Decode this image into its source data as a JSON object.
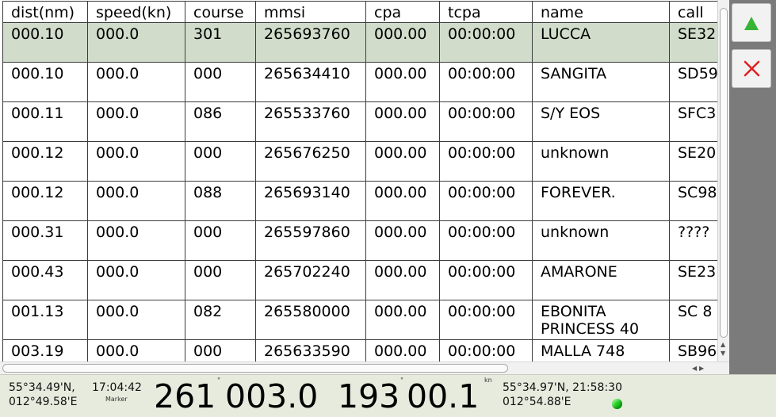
{
  "table": {
    "columns": [
      "dist(nm)",
      "speed(kn)",
      "course",
      "mmsi",
      "cpa",
      "tcpa",
      "name",
      "call"
    ],
    "rows": [
      {
        "dist": "000.10",
        "speed": "000.0",
        "course": "301",
        "mmsi": "265693760",
        "cpa": "000.00",
        "tcpa": "00:00:00",
        "name": "LUCCA",
        "call": "SE32"
      },
      {
        "dist": "000.10",
        "speed": "000.0",
        "course": "000",
        "mmsi": "265634410",
        "cpa": "000.00",
        "tcpa": "00:00:00",
        "name": "SANGITA",
        "call": "SD59"
      },
      {
        "dist": "000.11",
        "speed": "000.0",
        "course": "086",
        "mmsi": "265533760",
        "cpa": "000.00",
        "tcpa": "00:00:00",
        "name": "S/Y EOS",
        "call": "SFC3"
      },
      {
        "dist": "000.12",
        "speed": "000.0",
        "course": "000",
        "mmsi": "265676250",
        "cpa": "000.00",
        "tcpa": "00:00:00",
        "name": "unknown",
        "call": "SE20"
      },
      {
        "dist": "000.12",
        "speed": "000.0",
        "course": "088",
        "mmsi": "265693140",
        "cpa": "000.00",
        "tcpa": "00:00:00",
        "name": "FOREVER.",
        "call": "SC98"
      },
      {
        "dist": "000.31",
        "speed": "000.0",
        "course": "000",
        "mmsi": "265597860",
        "cpa": "000.00",
        "tcpa": "00:00:00",
        "name": "unknown",
        "call": "????"
      },
      {
        "dist": "000.43",
        "speed": "000.0",
        "course": "000",
        "mmsi": "265702240",
        "cpa": "000.00",
        "tcpa": "00:00:00",
        "name": "AMARONE",
        "call": "SE23"
      },
      {
        "dist": "001.13",
        "speed": "000.0",
        "course": "082",
        "mmsi": "265580000",
        "cpa": "000.00",
        "tcpa": "00:00:00",
        "name": "EBONITA PRINCESS 40",
        "call": "SC 8"
      },
      {
        "dist": "003.19",
        "speed": "000.0",
        "course": "000",
        "mmsi": "265633590",
        "cpa": "000.00",
        "tcpa": "00:00:00",
        "name": "MALLA 748",
        "call": "SB96"
      }
    ],
    "selected_row": 0
  },
  "side_panel": {
    "up_icon": "green-triangle-up-icon",
    "close_icon": "red-x-icon"
  },
  "status": {
    "marker_lat": "55°34.49'N,",
    "marker_time": "17:04:42",
    "marker_lon": "012°49.58'E",
    "marker_label": "Marker",
    "bearing_main": "261",
    "bearing_deg_symbol": "°",
    "distance_main": "003.0",
    "course_main": "193",
    "course_deg_symbol": "°",
    "speed_main": "00.1",
    "speed_unit": "kn",
    "pos_lat_time": "55°34.97'N, 21:58:30",
    "pos_lon": "012°54.88'E",
    "gps_fix_color": "#22cc22"
  },
  "colors": {
    "selected_row": "#d1dccb",
    "side_panel": "#7b7b7b",
    "status_bar": "#e7ebdd"
  }
}
